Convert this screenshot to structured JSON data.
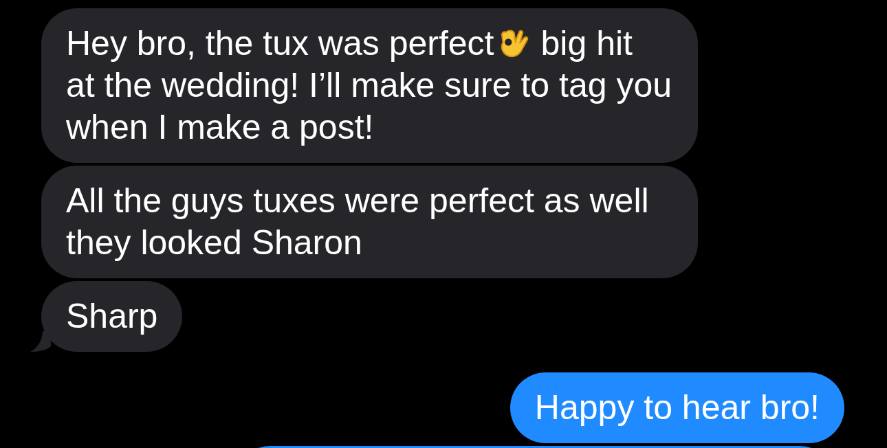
{
  "messages": [
    {
      "kind": "incoming",
      "tail": false,
      "parts": [
        {
          "kind": "text",
          "text": "Hey bro, the tux was perfect"
        },
        {
          "kind": "emoji"
        },
        {
          "kind": "text",
          "text": "big hit"
        },
        {
          "kind": "paragraph",
          "text": "at the wedding! I’ll make sure to tag you when I make a post!"
        }
      ]
    },
    {
      "kind": "incoming",
      "tail": false,
      "parts": [
        {
          "kind": "paragraph",
          "text": "All the guys tuxes were perfect as well they looked Sharon"
        }
      ]
    },
    {
      "kind": "incoming",
      "tail": true,
      "parts": [
        {
          "kind": "paragraph",
          "text": "Sharp"
        }
      ]
    },
    {
      "kind": "outgoing",
      "tail": false,
      "parts": [
        {
          "kind": "paragraph",
          "text": "Happy to hear bro!"
        }
      ]
    },
    {
      "kind": "outgoing"
    }
  ]
}
